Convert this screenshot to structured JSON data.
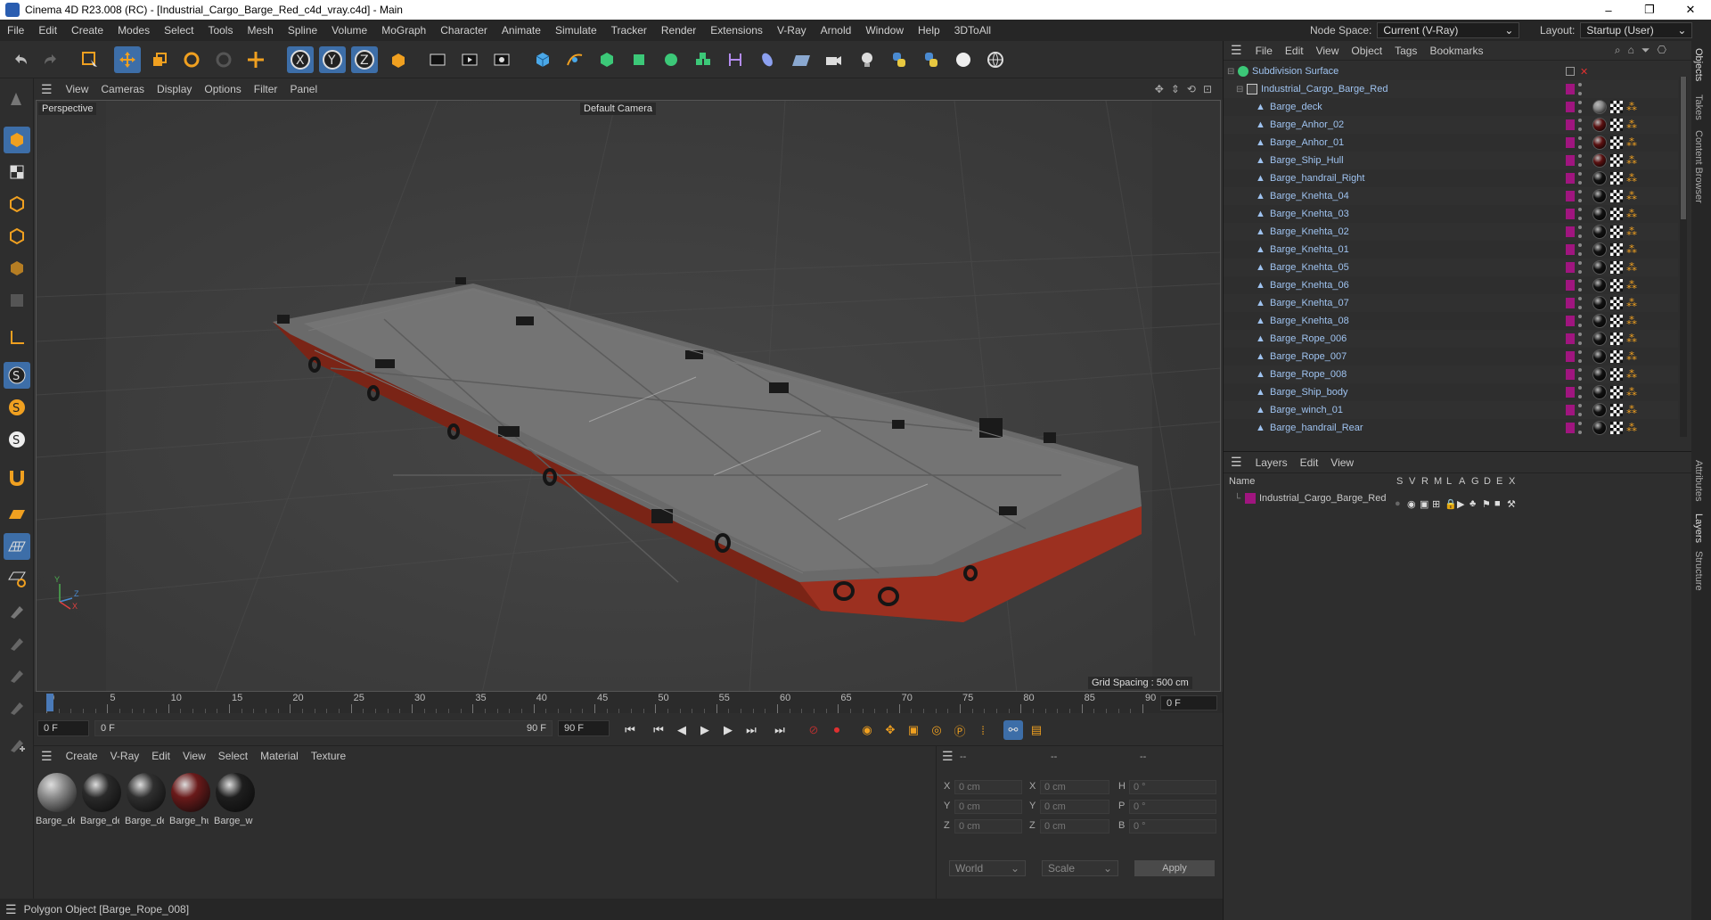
{
  "window": {
    "title": "Cinema 4D R23.008 (RC) - [Industrial_Cargo_Barge_Red_c4d_vray.c4d] - Main",
    "minimize": "–",
    "maximize": "❐",
    "close": "✕"
  },
  "menubar": {
    "items": [
      "File",
      "Edit",
      "Create",
      "Modes",
      "Select",
      "Tools",
      "Mesh",
      "Spline",
      "Volume",
      "MoGraph",
      "Character",
      "Animate",
      "Simulate",
      "Tracker",
      "Render",
      "Extensions",
      "V-Ray",
      "Arnold",
      "Window",
      "Help",
      "3DToAll"
    ],
    "node_space_label": "Node Space:",
    "node_space_value": "Current (V-Ray)",
    "layout_label": "Layout:",
    "layout_value": "Startup (User)"
  },
  "viewport": {
    "menu": [
      "View",
      "Cameras",
      "Display",
      "Options",
      "Filter",
      "Panel"
    ],
    "label": "Perspective",
    "camera": "Default Camera",
    "grid_spacing": "Grid Spacing : 500 cm",
    "axis_y": "Y",
    "axis_z": "Z",
    "axis_x": "X"
  },
  "timeline": {
    "ticks": [
      "0",
      "5",
      "10",
      "15",
      "20",
      "25",
      "30",
      "35",
      "40",
      "45",
      "50",
      "55",
      "60",
      "65",
      "70",
      "75",
      "80",
      "85",
      "90"
    ],
    "current_frame_right": "0 F",
    "start_field": "0 F",
    "range_start": "0 F",
    "range_end": "90 F",
    "end_field": "90 F",
    "progress": 0
  },
  "materials": {
    "menu": [
      "Create",
      "V-Ray",
      "Edit",
      "View",
      "Select",
      "Material",
      "Texture"
    ],
    "items": [
      {
        "label": "Barge_de",
        "color": "#8a8a8a"
      },
      {
        "label": "Barge_de",
        "color": "#2a2a2a"
      },
      {
        "label": "Barge_de",
        "color": "#2f2f2f"
      },
      {
        "label": "Barge_hu",
        "color": "#6a1a1a"
      },
      {
        "label": "Barge_w",
        "color": "#1e1e1e"
      }
    ]
  },
  "attributes": {
    "headers": [
      "--",
      "--",
      "--"
    ],
    "rows": [
      {
        "a": "X",
        "av": "0 cm",
        "b": "X",
        "bv": "0 cm",
        "c": "H",
        "cv": "0 °"
      },
      {
        "a": "Y",
        "av": "0 cm",
        "b": "Y",
        "bv": "0 cm",
        "c": "P",
        "cv": "0 °"
      },
      {
        "a": "Z",
        "av": "0 cm",
        "b": "Z",
        "bv": "0 cm",
        "c": "B",
        "cv": "0 °"
      }
    ],
    "coord_mode": "World",
    "size_mode": "Scale",
    "apply": "Apply"
  },
  "status": {
    "text": "Polygon Object [Barge_Rope_008]"
  },
  "objects": {
    "menu": [
      "File",
      "Edit",
      "View",
      "Object",
      "Tags",
      "Bookmarks"
    ],
    "root": "Subdivision Surface",
    "group": "Industrial_Cargo_Barge_Red",
    "items": [
      {
        "name": "Barge_deck",
        "tag": "#888888"
      },
      {
        "name": "Barge_Anhor_02",
        "tag": "#5a1010"
      },
      {
        "name": "Barge_Anhor_01",
        "tag": "#5a1010"
      },
      {
        "name": "Barge_Ship_Hull",
        "tag": "#5a1010"
      },
      {
        "name": "Barge_handrail_Right",
        "tag": "#111111"
      },
      {
        "name": "Barge_Knehta_04",
        "tag": "#111111"
      },
      {
        "name": "Barge_Knehta_03",
        "tag": "#111111"
      },
      {
        "name": "Barge_Knehta_02",
        "tag": "#111111"
      },
      {
        "name": "Barge_Knehta_01",
        "tag": "#111111"
      },
      {
        "name": "Barge_Knehta_05",
        "tag": "#111111"
      },
      {
        "name": "Barge_Knehta_06",
        "tag": "#111111"
      },
      {
        "name": "Barge_Knehta_07",
        "tag": "#111111"
      },
      {
        "name": "Barge_Knehta_08",
        "tag": "#111111"
      },
      {
        "name": "Barge_Rope_006",
        "tag": "#111111"
      },
      {
        "name": "Barge_Rope_007",
        "tag": "#111111"
      },
      {
        "name": "Barge_Rope_008",
        "tag": "#111111"
      },
      {
        "name": "Barge_Ship_body",
        "tag": "#111111"
      },
      {
        "name": "Barge_winch_01",
        "tag": "#111111"
      },
      {
        "name": "Barge_handrail_Rear",
        "tag": "#111111"
      }
    ]
  },
  "layers": {
    "menu": [
      "Layers",
      "Edit",
      "View"
    ],
    "name_header": "Name",
    "cols": [
      "S",
      "V",
      "R",
      "M",
      "L",
      "A",
      "G",
      "D",
      "E",
      "X"
    ],
    "items": [
      {
        "name": "Industrial_Cargo_Barge_Red",
        "color": "#a0157f"
      }
    ]
  },
  "side_tabs": [
    "Objects",
    "Takes",
    "Content Browser",
    "Attributes",
    "Layers",
    "Structure"
  ],
  "colors": {
    "accent": "#3d6ea8",
    "hull": "#8b2a1c",
    "layer": "#a0157f"
  }
}
